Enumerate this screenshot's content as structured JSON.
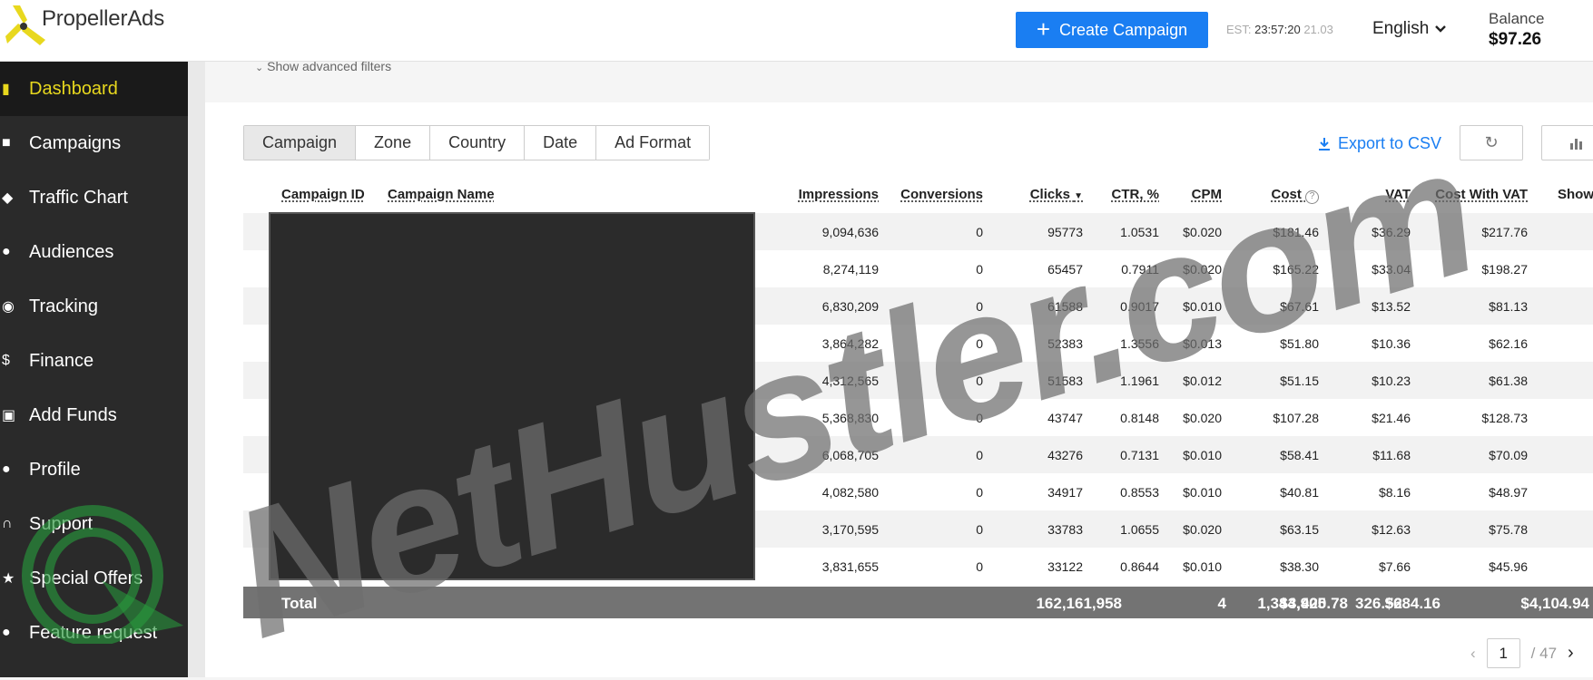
{
  "header": {
    "logo_text": "PropellerAds",
    "create_label": "Create Campaign",
    "clock_prefix": "EST:",
    "clock_time": "23:57:20",
    "clock_date": "21.03",
    "language": "English",
    "balance_label": "Balance",
    "balance_value": "$97.26"
  },
  "sidebar": {
    "items": [
      {
        "label": "Dashboard",
        "icon": "bar-chart-icon",
        "glyph": "▮"
      },
      {
        "label": "Campaigns",
        "icon": "briefcase-icon",
        "glyph": "■"
      },
      {
        "label": "Traffic Chart",
        "icon": "map-pin-icon",
        "glyph": "◆"
      },
      {
        "label": "Audiences",
        "icon": "people-icon",
        "glyph": "●"
      },
      {
        "label": "Tracking",
        "icon": "eye-icon",
        "glyph": "◉"
      },
      {
        "label": "Finance",
        "icon": "dollar-icon",
        "glyph": "$"
      },
      {
        "label": "Add Funds",
        "icon": "wallet-icon",
        "glyph": "▣"
      },
      {
        "label": "Profile",
        "icon": "person-icon",
        "glyph": "●"
      },
      {
        "label": "Support",
        "icon": "headset-icon",
        "glyph": "∩"
      },
      {
        "label": "Special Offers",
        "icon": "star-icon",
        "glyph": "★"
      },
      {
        "label": "Feature request",
        "icon": "person-voice-icon",
        "glyph": "●"
      }
    ]
  },
  "filters": {
    "advanced_label": "Show advanced filters"
  },
  "tabs": [
    "Campaign",
    "Zone",
    "Country",
    "Date",
    "Ad Format"
  ],
  "toolbar": {
    "export_label": "Export to CSV"
  },
  "table": {
    "headers": {
      "campaign_id": "Campaign ID",
      "campaign_name": "Campaign Name",
      "impressions": "Impressions",
      "conversions": "Conversions",
      "clicks": "Clicks",
      "ctr": "CTR, %",
      "cpm": "CPM",
      "cost": "Cost",
      "vat": "VAT",
      "cost_vat": "Cost With VAT",
      "show": "Show"
    },
    "rows": [
      {
        "impressions": "9,094,636",
        "conversions": "0",
        "clicks": "95773",
        "ctr": "1.0531",
        "cpm": "$0.020",
        "cost": "$181.46",
        "vat": "$36.29",
        "cost_vat": "$217.76"
      },
      {
        "impressions": "8,274,119",
        "conversions": "0",
        "clicks": "65457",
        "ctr": "0.7911",
        "cpm": "$0.020",
        "cost": "$165.22",
        "vat": "$33.04",
        "cost_vat": "$198.27"
      },
      {
        "impressions": "6,830,209",
        "conversions": "0",
        "clicks": "61588",
        "ctr": "0.9017",
        "cpm": "$0.010",
        "cost": "$67.61",
        "vat": "$13.52",
        "cost_vat": "$81.13"
      },
      {
        "impressions": "3,864,282",
        "conversions": "0",
        "clicks": "52383",
        "ctr": "1.3556",
        "cpm": "$0.013",
        "cost": "$51.80",
        "vat": "$10.36",
        "cost_vat": "$62.16"
      },
      {
        "impressions": "4,312,565",
        "conversions": "0",
        "clicks": "51583",
        "ctr": "1.1961",
        "cpm": "$0.012",
        "cost": "$51.15",
        "vat": "$10.23",
        "cost_vat": "$61.38"
      },
      {
        "impressions": "5,368,830",
        "conversions": "0",
        "clicks": "43747",
        "ctr": "0.8148",
        "cpm": "$0.020",
        "cost": "$107.28",
        "vat": "$21.46",
        "cost_vat": "$128.73"
      },
      {
        "impressions": "6,068,705",
        "conversions": "0",
        "clicks": "43276",
        "ctr": "0.7131",
        "cpm": "$0.010",
        "cost": "$58.41",
        "vat": "$11.68",
        "cost_vat": "$70.09"
      },
      {
        "impressions": "4,082,580",
        "conversions": "0",
        "clicks": "34917",
        "ctr": "0.8553",
        "cpm": "$0.010",
        "cost": "$40.81",
        "vat": "$8.16",
        "cost_vat": "$48.97"
      },
      {
        "impressions": "3,170,595",
        "conversions": "0",
        "clicks": "33783",
        "ctr": "1.0655",
        "cpm": "$0.020",
        "cost": "$63.15",
        "vat": "$12.63",
        "cost_vat": "$75.78"
      },
      {
        "impressions": "3,831,655",
        "conversions": "0",
        "clicks": "33122",
        "ctr": "0.8644",
        "cpm": "$0.010",
        "cost": "$38.30",
        "vat": "$7.66",
        "cost_vat": "$45.96"
      }
    ],
    "total": {
      "label": "Total",
      "impressions": "162,161,958",
      "conversions": "4",
      "clicks": "1,344,905",
      "ctr": "326.52",
      "cost": "$3,420.78",
      "vat": "$684.16",
      "cost_vat": "$4,104.94"
    }
  },
  "pagination": {
    "current": "1",
    "total": "/ 47"
  },
  "watermark": "NetHustler.com",
  "colors": {
    "accent": "#1a7ef2",
    "sidebar": "#2a2a2a",
    "active_nav": "#e8d81e"
  }
}
